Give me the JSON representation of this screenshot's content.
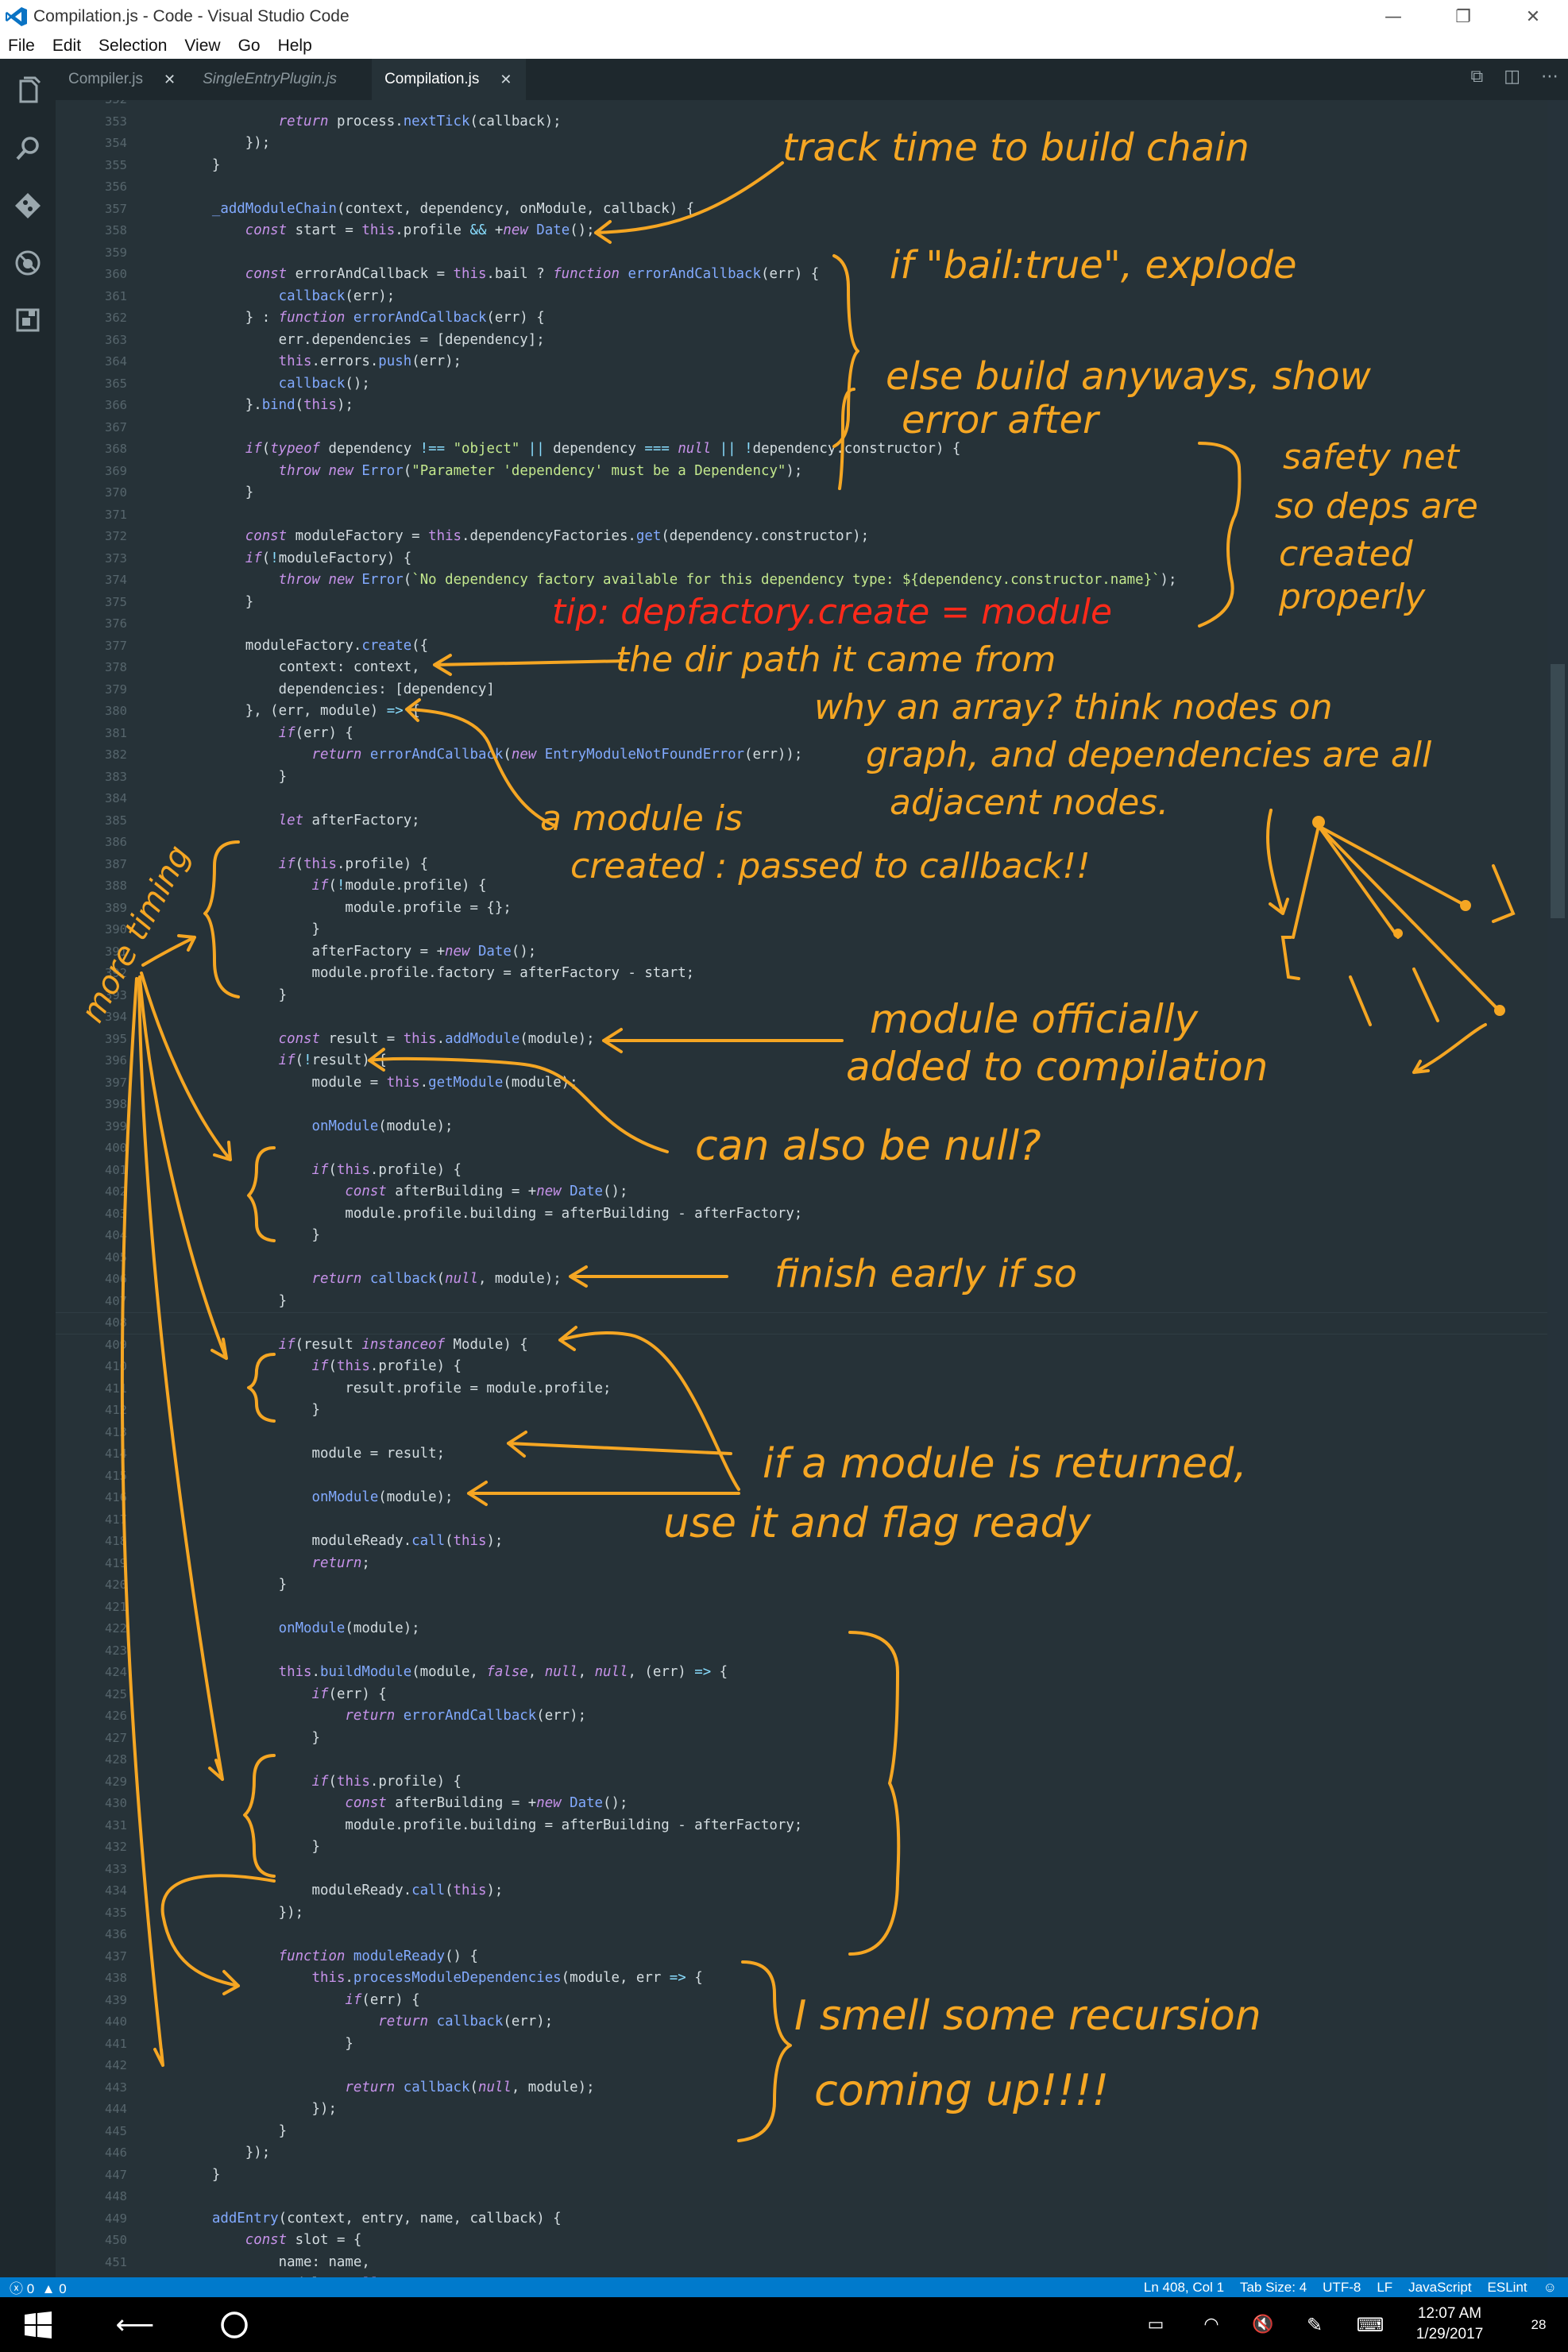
{
  "window": {
    "title": "Compilation.js - Code - Visual Studio Code",
    "controls": {
      "minimize": "—",
      "restore": "❐",
      "close": "✕"
    }
  },
  "menu": [
    "File",
    "Edit",
    "Selection",
    "View",
    "Go",
    "Help"
  ],
  "activity_bar": [
    "explorer-icon",
    "search-icon",
    "git-icon",
    "debug-icon",
    "extensions-icon"
  ],
  "tabs": [
    {
      "label": "Compiler.js",
      "italic": false,
      "active": false,
      "close": "✕"
    },
    {
      "label": "SingleEntryPlugin.js",
      "italic": true,
      "active": false,
      "close": ""
    },
    {
      "label": "Compilation.js",
      "italic": false,
      "active": true,
      "close": "✕"
    }
  ],
  "editor_actions": [
    "open-changes-icon",
    "split-editor-icon",
    "more-icon"
  ],
  "editor": {
    "current_line": 408,
    "code_lines": [
      {
        "n": "352",
        "t": ""
      },
      {
        "n": "353",
        "t": "            return process.nextTick(callback);"
      },
      {
        "n": "354",
        "t": "        });"
      },
      {
        "n": "355",
        "t": "    }"
      },
      {
        "n": "356",
        "t": ""
      },
      {
        "n": "357",
        "t": "    _addModuleChain(context, dependency, onModule, callback) {"
      },
      {
        "n": "358",
        "t": "        const start = this.profile && +new Date();"
      },
      {
        "n": "359",
        "t": ""
      },
      {
        "n": "360",
        "t": "        const errorAndCallback = this.bail ? function errorAndCallback(err) {"
      },
      {
        "n": "361",
        "t": "            callback(err);"
      },
      {
        "n": "362",
        "t": "        } : function errorAndCallback(err) {"
      },
      {
        "n": "363",
        "t": "            err.dependencies = [dependency];"
      },
      {
        "n": "364",
        "t": "            this.errors.push(err);"
      },
      {
        "n": "365",
        "t": "            callback();"
      },
      {
        "n": "366",
        "t": "        }.bind(this);"
      },
      {
        "n": "367",
        "t": ""
      },
      {
        "n": "368",
        "t": "        if(typeof dependency !== \"object\" || dependency === null || !dependency.constructor) {"
      },
      {
        "n": "369",
        "t": "            throw new Error(\"Parameter 'dependency' must be a Dependency\");"
      },
      {
        "n": "370",
        "t": "        }"
      },
      {
        "n": "371",
        "t": ""
      },
      {
        "n": "372",
        "t": "        const moduleFactory = this.dependencyFactories.get(dependency.constructor);"
      },
      {
        "n": "373",
        "t": "        if(!moduleFactory) {"
      },
      {
        "n": "374",
        "t": "            throw new Error(`No dependency factory available for this dependency type: ${dependency.constructor.name}`);"
      },
      {
        "n": "375",
        "t": "        }"
      },
      {
        "n": "376",
        "t": ""
      },
      {
        "n": "377",
        "t": "        moduleFactory.create({"
      },
      {
        "n": "378",
        "t": "            context: context,"
      },
      {
        "n": "379",
        "t": "            dependencies: [dependency]"
      },
      {
        "n": "380",
        "t": "        }, (err, module) => {"
      },
      {
        "n": "381",
        "t": "            if(err) {"
      },
      {
        "n": "382",
        "t": "                return errorAndCallback(new EntryModuleNotFoundError(err));"
      },
      {
        "n": "383",
        "t": "            }"
      },
      {
        "n": "384",
        "t": ""
      },
      {
        "n": "385",
        "t": "            let afterFactory;"
      },
      {
        "n": "386",
        "t": ""
      },
      {
        "n": "387",
        "t": "            if(this.profile) {"
      },
      {
        "n": "388",
        "t": "                if(!module.profile) {"
      },
      {
        "n": "389",
        "t": "                    module.profile = {};"
      },
      {
        "n": "390",
        "t": "                }"
      },
      {
        "n": "391",
        "t": "                afterFactory = +new Date();"
      },
      {
        "n": "392",
        "t": "                module.profile.factory = afterFactory - start;"
      },
      {
        "n": "393",
        "t": "            }"
      },
      {
        "n": "394",
        "t": ""
      },
      {
        "n": "395",
        "t": "            const result = this.addModule(module);"
      },
      {
        "n": "396",
        "t": "            if(!result) {"
      },
      {
        "n": "397",
        "t": "                module = this.getModule(module);"
      },
      {
        "n": "398",
        "t": ""
      },
      {
        "n": "399",
        "t": "                onModule(module);"
      },
      {
        "n": "400",
        "t": ""
      },
      {
        "n": "401",
        "t": "                if(this.profile) {"
      },
      {
        "n": "402",
        "t": "                    const afterBuilding = +new Date();"
      },
      {
        "n": "403",
        "t": "                    module.profile.building = afterBuilding - afterFactory;"
      },
      {
        "n": "404",
        "t": "                }"
      },
      {
        "n": "405",
        "t": ""
      },
      {
        "n": "406",
        "t": "                return callback(null, module);"
      },
      {
        "n": "407",
        "t": "            }"
      },
      {
        "n": "408",
        "t": ""
      },
      {
        "n": "409",
        "t": "            if(result instanceof Module) {"
      },
      {
        "n": "410",
        "t": "                if(this.profile) {"
      },
      {
        "n": "411",
        "t": "                    result.profile = module.profile;"
      },
      {
        "n": "412",
        "t": "                }"
      },
      {
        "n": "413",
        "t": ""
      },
      {
        "n": "414",
        "t": "                module = result;"
      },
      {
        "n": "415",
        "t": ""
      },
      {
        "n": "416",
        "t": "                onModule(module);"
      },
      {
        "n": "417",
        "t": ""
      },
      {
        "n": "418",
        "t": "                moduleReady.call(this);"
      },
      {
        "n": "419",
        "t": "                return;"
      },
      {
        "n": "420",
        "t": "            }"
      },
      {
        "n": "421",
        "t": ""
      },
      {
        "n": "422",
        "t": "            onModule(module);"
      },
      {
        "n": "423",
        "t": ""
      },
      {
        "n": "424",
        "t": "            this.buildModule(module, false, null, null, (err) => {"
      },
      {
        "n": "425",
        "t": "                if(err) {"
      },
      {
        "n": "426",
        "t": "                    return errorAndCallback(err);"
      },
      {
        "n": "427",
        "t": "                }"
      },
      {
        "n": "428",
        "t": ""
      },
      {
        "n": "429",
        "t": "                if(this.profile) {"
      },
      {
        "n": "430",
        "t": "                    const afterBuilding = +new Date();"
      },
      {
        "n": "431",
        "t": "                    module.profile.building = afterBuilding - afterFactory;"
      },
      {
        "n": "432",
        "t": "                }"
      },
      {
        "n": "433",
        "t": ""
      },
      {
        "n": "434",
        "t": "                moduleReady.call(this);"
      },
      {
        "n": "435",
        "t": "            });"
      },
      {
        "n": "436",
        "t": ""
      },
      {
        "n": "437",
        "t": "            function moduleReady() {"
      },
      {
        "n": "438",
        "t": "                this.processModuleDependencies(module, err => {"
      },
      {
        "n": "439",
        "t": "                    if(err) {"
      },
      {
        "n": "440",
        "t": "                        return callback(err);"
      },
      {
        "n": "441",
        "t": "                    }"
      },
      {
        "n": "442",
        "t": ""
      },
      {
        "n": "443",
        "t": "                    return callback(null, module);"
      },
      {
        "n": "444",
        "t": "                });"
      },
      {
        "n": "445",
        "t": "            }"
      },
      {
        "n": "446",
        "t": "        });"
      },
      {
        "n": "447",
        "t": "    }"
      },
      {
        "n": "448",
        "t": ""
      },
      {
        "n": "449",
        "t": "    addEntry(context, entry, name, callback) {"
      },
      {
        "n": "450",
        "t": "        const slot = {"
      },
      {
        "n": "451",
        "t": "            name: name,"
      },
      {
        "n": "452",
        "t": "            module: null"
      }
    ]
  },
  "annotations": [
    {
      "text": "track time to build chain",
      "color": "#f5a623"
    },
    {
      "text": "if \"bail:true\", explode",
      "color": "#f5a623"
    },
    {
      "text": "else build anyways, show",
      "color": "#f5a623"
    },
    {
      "text": "error after",
      "color": "#f5a623"
    },
    {
      "text": "safety net",
      "color": "#f5a623"
    },
    {
      "text": "so deps are",
      "color": "#f5a623"
    },
    {
      "text": "created",
      "color": "#f5a623"
    },
    {
      "text": "properly",
      "color": "#f5a623"
    },
    {
      "text": "tip: depfactory.create = module",
      "color": "#ff2a1a"
    },
    {
      "text": "the dir path it came from",
      "color": "#f5a623"
    },
    {
      "text": "why an array? think nodes on",
      "color": "#f5a623"
    },
    {
      "text": "graph, and dependencies are all",
      "color": "#f5a623"
    },
    {
      "text": "adjacent nodes.",
      "color": "#f5a623"
    },
    {
      "text": "a module is",
      "color": "#f5a623"
    },
    {
      "text": "created : passed to callback!!",
      "color": "#f5a623"
    },
    {
      "text": "more timing",
      "color": "#f5a623"
    },
    {
      "text": "module officially",
      "color": "#f5a623"
    },
    {
      "text": "added to compilation",
      "color": "#f5a623"
    },
    {
      "text": "can also be null?",
      "color": "#f5a623"
    },
    {
      "text": "finish early if so",
      "color": "#f5a623"
    },
    {
      "text": "if a module is returned,",
      "color": "#f5a623"
    },
    {
      "text": "use it and flag ready",
      "color": "#f5a623"
    },
    {
      "text": "I smell some recursion",
      "color": "#f5a623"
    },
    {
      "text": "coming up!!!!",
      "color": "#f5a623"
    }
  ],
  "status": {
    "errors": "0",
    "warnings": "0",
    "position": "Ln 408, Col 1",
    "tab_size": "Tab Size: 4",
    "encoding": "UTF-8",
    "eol": "LF",
    "language": "JavaScript",
    "linter": "ESLint"
  },
  "taskbar": {
    "time": "12:07 AM",
    "date": "1/29/2017",
    "notifications": "28",
    "icons": [
      "windows-start-icon",
      "back-icon",
      "cortana-icon",
      "battery-icon",
      "wifi-icon",
      "volume-muted-icon",
      "pen-icon",
      "keyboard-icon",
      "action-center-icon"
    ]
  },
  "colors": {
    "editor_bg": "#263238",
    "status_bg": "#007acc",
    "annotation_orange": "#f5a623",
    "annotation_red": "#ff2a1a"
  }
}
